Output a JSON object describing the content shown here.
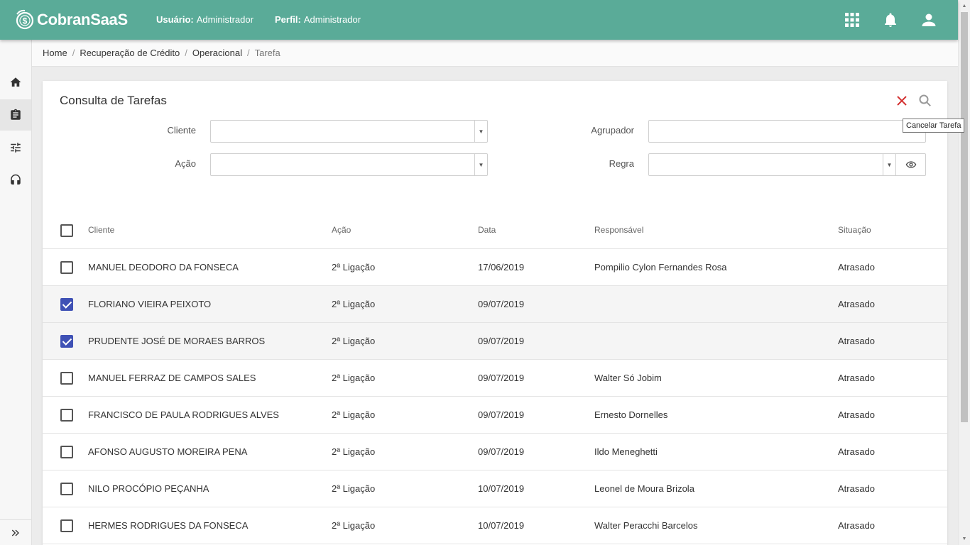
{
  "app": {
    "name": "CobranSaaS",
    "user_label": "Usuário:",
    "user_value": "Administrador",
    "profile_label": "Perfil:",
    "profile_value": "Administrador"
  },
  "header_icons": [
    "apps-grid-icon",
    "bell-icon",
    "account-icon"
  ],
  "sidebar": {
    "items": [
      {
        "name": "home-icon"
      },
      {
        "name": "clipboard-icon",
        "active": true
      },
      {
        "name": "sliders-icon"
      },
      {
        "name": "headset-icon"
      }
    ],
    "expand_icon": "double-chevron-right-icon"
  },
  "breadcrumb": [
    "Home",
    "Recuperação de Crédito",
    "Operacional",
    "Tarefa"
  ],
  "card": {
    "title": "Consulta de Tarefas",
    "tooltip": "Cancelar Tarefa",
    "cancel_color": "#d32f2f"
  },
  "filters": {
    "cliente_label": "Cliente",
    "agrupador_label": "Agrupador",
    "acao_label": "Ação",
    "regra_label": "Regra"
  },
  "table": {
    "headers": [
      "Cliente",
      "Ação",
      "Data",
      "Responsável",
      "Situação"
    ],
    "rows": [
      {
        "checked": false,
        "cliente": "MANUEL DEODORO DA FONSECA",
        "acao": "2ª Ligação",
        "data": "17/06/2019",
        "responsavel": "Pompilio Cylon Fernandes Rosa",
        "situacao": "Atrasado"
      },
      {
        "checked": true,
        "cliente": "FLORIANO VIEIRA PEIXOTO",
        "acao": "2ª Ligação",
        "data": "09/07/2019",
        "responsavel": "",
        "situacao": "Atrasado"
      },
      {
        "checked": true,
        "cliente": "PRUDENTE JOSÉ DE MORAES BARROS",
        "acao": "2ª Ligação",
        "data": "09/07/2019",
        "responsavel": "",
        "situacao": "Atrasado"
      },
      {
        "checked": false,
        "cliente": "MANUEL FERRAZ DE CAMPOS SALES",
        "acao": "2ª Ligação",
        "data": "09/07/2019",
        "responsavel": "Walter Só Jobim",
        "situacao": "Atrasado"
      },
      {
        "checked": false,
        "cliente": "FRANCISCO DE PAULA RODRIGUES ALVES",
        "acao": "2ª Ligação",
        "data": "09/07/2019",
        "responsavel": "Ernesto Dornelles",
        "situacao": "Atrasado"
      },
      {
        "checked": false,
        "cliente": "AFONSO AUGUSTO MOREIRA PENA",
        "acao": "2ª Ligação",
        "data": "09/07/2019",
        "responsavel": "Ildo Meneghetti",
        "situacao": "Atrasado"
      },
      {
        "checked": false,
        "cliente": "NILO PROCÓPIO PEÇANHA",
        "acao": "2ª Ligação",
        "data": "10/07/2019",
        "responsavel": "Leonel de Moura Brizola",
        "situacao": "Atrasado"
      },
      {
        "checked": false,
        "cliente": "HERMES RODRIGUES DA FONSECA",
        "acao": "2ª Ligação",
        "data": "10/07/2019",
        "responsavel": "Walter Peracchi Barcelos",
        "situacao": "Atrasado"
      }
    ]
  },
  "colors": {
    "primary": "#5aab98",
    "checkbox": "#3f51b5"
  }
}
